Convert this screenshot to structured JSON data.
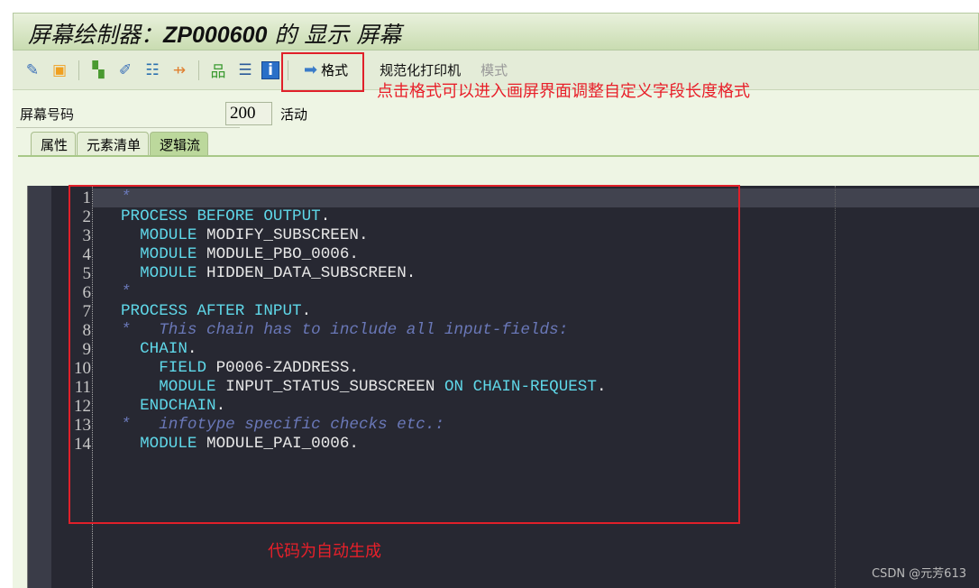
{
  "title": {
    "prefix": "屏幕绘制器：",
    "program": "ZP000600",
    "suffix": " 的 显示 屏幕"
  },
  "toolbar": {
    "icons": [
      "other-object-icon",
      "display-change-icon",
      "where-used-icon",
      "activate-icon",
      "layout-icon",
      "navigation-icon",
      "hierarchy-icon",
      "stack-icon",
      "info-icon"
    ],
    "format_button": "格式",
    "normalize_printer": "规范化打印机",
    "mode": "模式"
  },
  "screen": {
    "label": "屏幕号码",
    "number": "200",
    "status": "活动"
  },
  "tabs": [
    {
      "label": "属性"
    },
    {
      "label": "元素清单"
    },
    {
      "label": "逻辑流",
      "active": true
    }
  ],
  "code": [
    [
      [
        "cm",
        "*"
      ]
    ],
    [
      [
        "kw",
        "PROCESS BEFORE OUTPUT"
      ],
      [
        "pt",
        "."
      ]
    ],
    [
      [
        "pt",
        "  "
      ],
      [
        "kw",
        "MODULE"
      ],
      [
        "id",
        " MODIFY_SUBSCREEN"
      ],
      [
        "pt",
        "."
      ]
    ],
    [
      [
        "pt",
        "  "
      ],
      [
        "kw",
        "MODULE"
      ],
      [
        "id",
        " MODULE_PBO_0006"
      ],
      [
        "pt",
        "."
      ]
    ],
    [
      [
        "pt",
        "  "
      ],
      [
        "kw",
        "MODULE"
      ],
      [
        "id",
        " HIDDEN_DATA_SUBSCREEN"
      ],
      [
        "pt",
        "."
      ]
    ],
    [
      [
        "cm",
        "*"
      ]
    ],
    [
      [
        "kw",
        "PROCESS AFTER INPUT"
      ],
      [
        "pt",
        "."
      ]
    ],
    [
      [
        "cm",
        "*   This chain has to include all input-fields:"
      ]
    ],
    [
      [
        "pt",
        "  "
      ],
      [
        "kw",
        "CHAIN"
      ],
      [
        "pt",
        "."
      ]
    ],
    [
      [
        "pt",
        "    "
      ],
      [
        "kw",
        "FIELD"
      ],
      [
        "id",
        " P0006-ZADDRESS"
      ],
      [
        "pt",
        "."
      ]
    ],
    [
      [
        "pt",
        "    "
      ],
      [
        "kw",
        "MODULE"
      ],
      [
        "id",
        " INPUT_STATUS_SUBSCREEN "
      ],
      [
        "kw",
        "ON CHAIN-REQUEST"
      ],
      [
        "pt",
        "."
      ]
    ],
    [
      [
        "pt",
        "  "
      ],
      [
        "kw",
        "ENDCHAIN"
      ],
      [
        "pt",
        "."
      ]
    ],
    [
      [
        "cm",
        "*   infotype specific checks etc.:"
      ]
    ],
    [
      [
        "pt",
        "  "
      ],
      [
        "kw",
        "MODULE"
      ],
      [
        "id",
        " MODULE_PAI_0006"
      ],
      [
        "pt",
        "."
      ]
    ]
  ],
  "annotations": {
    "format_note": "点击格式可以进入画屏界面调整自定义字段长度格式",
    "code_note": "代码为自动生成"
  },
  "watermark": "CSDN @元芳613",
  "colors": {
    "annotation": "#e8202a",
    "keyword": "#5fd7e8",
    "comment": "#6a78b8",
    "editor_bg": "#272832"
  }
}
